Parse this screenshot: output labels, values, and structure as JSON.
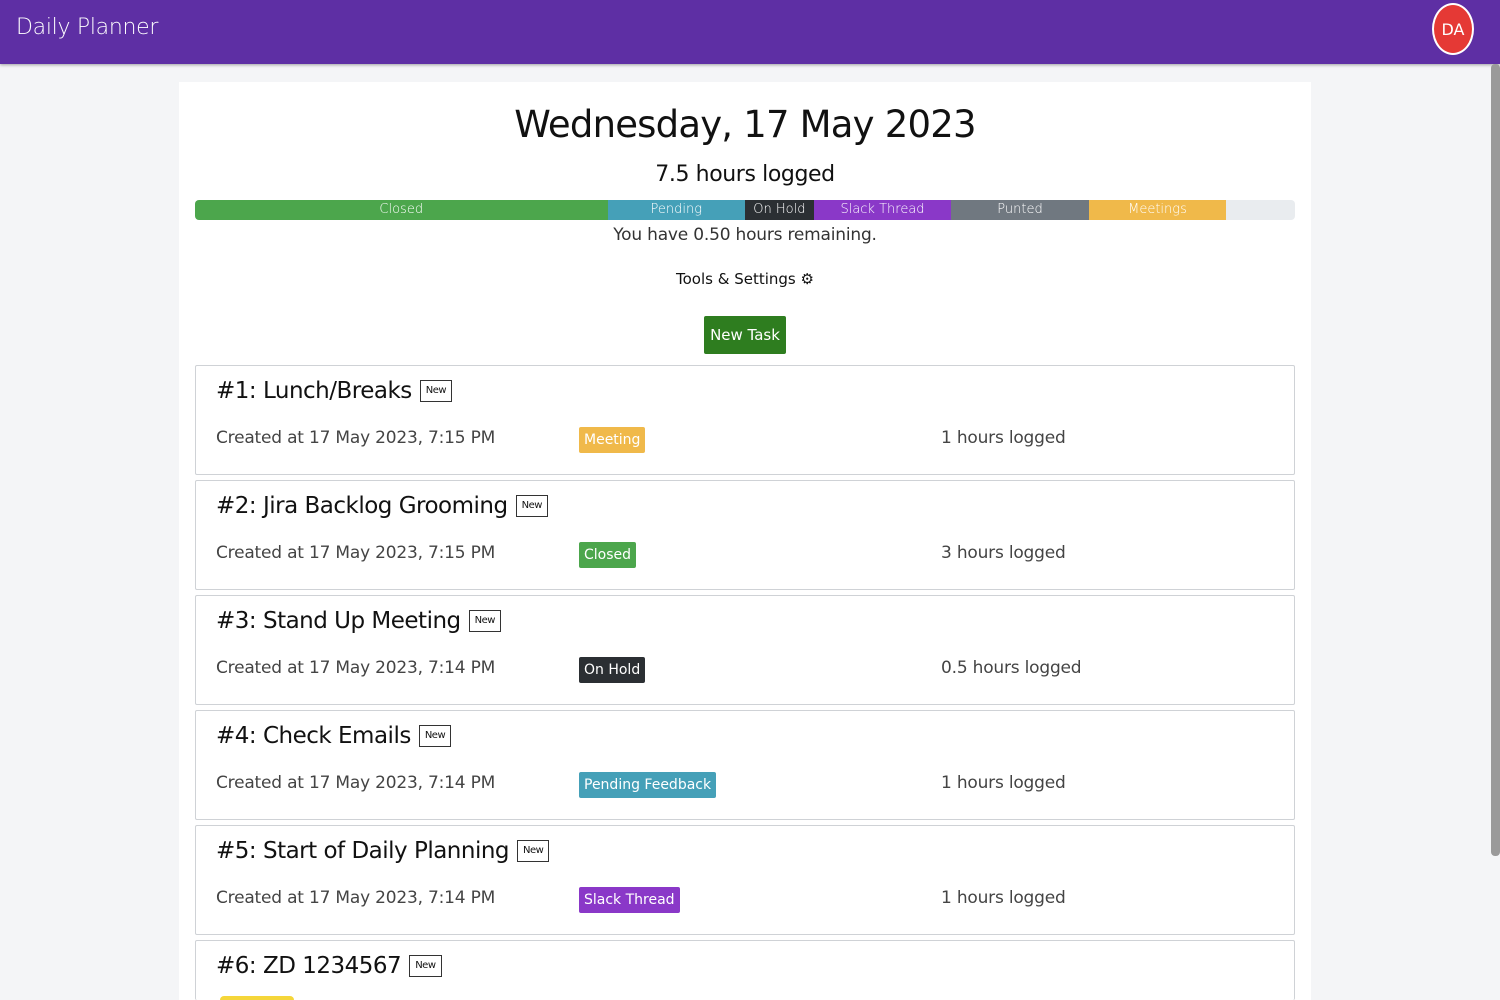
{
  "navbar": {
    "brand": "Daily Planner",
    "avatar_initials": "DA",
    "color": "#5e2fa4",
    "avatar_color": "#e53935"
  },
  "summary": {
    "date_title": "Wednesday, 17 May 2023",
    "hours_logged": "7.5 hours logged",
    "remaining": "You have 0.50 hours remaining.",
    "tools_label": "Tools & Settings",
    "tools_icon": "gear-icon",
    "new_task_label": "New Task"
  },
  "progress": {
    "total_hours": 8,
    "segments": [
      {
        "label": "Closed",
        "hours": 3,
        "color": "#4ca64c"
      },
      {
        "label": "Pending",
        "hours": 1,
        "color": "#45a0b8"
      },
      {
        "label": "On Hold",
        "hours": 0.5,
        "color": "#2b2f33"
      },
      {
        "label": "Slack Thread",
        "hours": 1,
        "color": "#8a38c8"
      },
      {
        "label": "Punted",
        "hours": 1,
        "color": "#707880"
      },
      {
        "label": "Meetings",
        "hours": 1,
        "color": "#f0b94a"
      }
    ]
  },
  "tasks": [
    {
      "title": "#1: Lunch/Breaks",
      "badge": "New",
      "created": "Created at 17 May 2023, 7:15 PM",
      "status": "Meeting",
      "status_color": "#f0b94a",
      "logged": "1 hours logged"
    },
    {
      "title": "#2: Jira Backlog Grooming",
      "badge": "New",
      "created": "Created at 17 May 2023, 7:15 PM",
      "status": "Closed",
      "status_color": "#4ca64c",
      "logged": "3 hours logged"
    },
    {
      "title": "#3: Stand Up Meeting",
      "badge": "New",
      "created": "Created at 17 May 2023, 7:14 PM",
      "status": "On Hold",
      "status_color": "#2b2f33",
      "logged": "0.5 hours logged"
    },
    {
      "title": "#4: Check Emails",
      "badge": "New",
      "created": "Created at 17 May 2023, 7:14 PM",
      "status": "Pending Feedback",
      "status_color": "#45a0b8",
      "logged": "1 hours logged"
    },
    {
      "title": "#5: Start of Daily Planning",
      "badge": "New",
      "created": "Created at 17 May 2023, 7:14 PM",
      "status": "Slack Thread",
      "status_color": "#8a38c8",
      "logged": "1 hours logged"
    },
    {
      "title": "#6: ZD 1234567",
      "badge": "New",
      "created": "",
      "status": "",
      "status_color": "#f5d63a",
      "logged": ""
    }
  ]
}
